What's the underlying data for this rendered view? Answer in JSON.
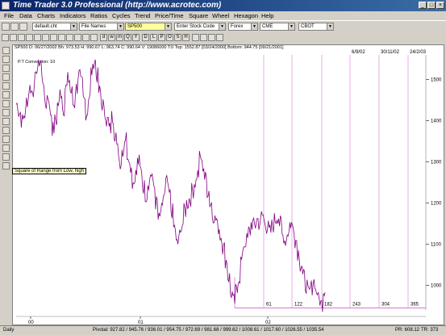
{
  "window": {
    "title": "Time Trader 3.0 Professional (http://www.acrotec.com)",
    "minimize_glyph": "_",
    "maximize_glyph": "□",
    "close_glyph": "×"
  },
  "menu": [
    "File",
    "Data",
    "Charts",
    "Indicators",
    "Ratios",
    "Cycles",
    "Trend",
    "Price/Time",
    "Square",
    "Wheel",
    "Hexagon",
    "Help"
  ],
  "toolbar": {
    "chart_file": "default.cht",
    "file_names": "File Names",
    "symbol": "SP500",
    "stock_code": "Enter Stock Code",
    "forex": "Forex",
    "exchange1": "CME",
    "exchange2": "CBOT"
  },
  "toolbar2_labels": [
    "d",
    "w",
    "m",
    "Q",
    "Y",
    "D",
    "L",
    "P",
    "O",
    "S",
    "H"
  ],
  "info_line": "SP500   D: 06/27/2002  Bh: 973.53  H: 990.67  L: 963.74  C: 990.64  V: 19086000  T:0     Top: 1552.87 [03/24/2000]   Bottom: 944.75 [09/21/2001]",
  "chart_label": "P.T Conversion: 10",
  "tooltip": "Square of Range from Low, high",
  "status": {
    "period": "Daily",
    "pivots": "Pivotal: 927.82 / 945.76 / 936.01 / 954.75 / 972.69 / 981.68 / 999.62 / 1008.61 / 1017.60 / 1026.55 / 1035.54",
    "pr": "PR: 608.12",
    "tr": "TR: 373"
  },
  "chart_data": {
    "type": "line",
    "symbol": "SP500",
    "y_ticks": [
      1500,
      1400,
      1300,
      1200,
      1100,
      1000
    ],
    "ylim": [
      940,
      1560
    ],
    "x_ticks": [
      "00",
      "01",
      "02"
    ],
    "cycle_labels_bottom": [
      "61",
      "122",
      "182",
      "243",
      "304",
      "365"
    ],
    "cycle_labels_top": [
      "6/9/02",
      "30/11/02",
      "24/2/03"
    ],
    "series": [
      {
        "values": [
          1440,
          1420,
          1400,
          1415,
          1450,
          1480,
          1470,
          1500,
          1530,
          1545,
          1500,
          1440,
          1460,
          1420,
          1380,
          1400,
          1440,
          1470,
          1430,
          1480,
          1500,
          1470,
          1440,
          1480,
          1510,
          1490,
          1450,
          1420,
          1460,
          1520,
          1545,
          1510,
          1470,
          1440,
          1420,
          1400,
          1380,
          1410,
          1370,
          1330,
          1300,
          1330,
          1360,
          1320,
          1290,
          1250,
          1270,
          1300,
          1280,
          1240,
          1220,
          1250,
          1270,
          1240,
          1200,
          1160,
          1180,
          1220,
          1250,
          1220,
          1180,
          1140,
          1100,
          1120,
          1150,
          1180,
          1200,
          1210,
          1230,
          1250,
          1270,
          1310,
          1290,
          1260,
          1230,
          1200,
          1170,
          1160,
          1140,
          1120,
          1090,
          1060,
          1020,
          980,
          960,
          985,
          1020,
          1060,
          1100,
          1110,
          1130,
          1150,
          1145,
          1160,
          1150,
          1170,
          1155,
          1140,
          1130,
          1145,
          1160,
          1168,
          1150,
          1120,
          1110,
          1130,
          1150,
          1140,
          1110,
          1080,
          1050,
          1020,
          1000,
          980,
          995,
          1010,
          985,
          965,
          955,
          990
        ]
      }
    ]
  }
}
